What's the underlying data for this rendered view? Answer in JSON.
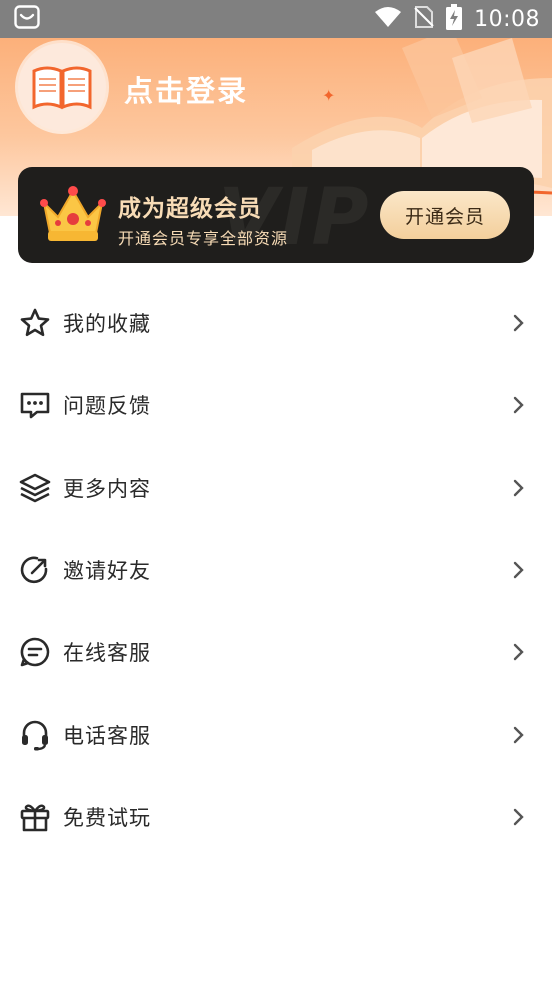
{
  "status_bar": {
    "time": "10:08",
    "icons": [
      "notification-icon",
      "wifi-icon",
      "no-sim-icon",
      "battery-icon"
    ]
  },
  "header": {
    "login_text": "点击登录",
    "avatar_icon": "book-icon"
  },
  "vip": {
    "watermark": "VIP",
    "title": "成为超级会员",
    "subtitle": "开通会员专享全部资源",
    "button_label": "开通会员",
    "crown_icon": "crown-icon"
  },
  "menu": {
    "items": [
      {
        "label": "我的收藏",
        "icon": "star-icon"
      },
      {
        "label": "问题反馈",
        "icon": "feedback-icon"
      },
      {
        "label": "更多内容",
        "icon": "layers-icon"
      },
      {
        "label": "邀请好友",
        "icon": "share-icon"
      },
      {
        "label": "在线客服",
        "icon": "chat-icon"
      },
      {
        "label": "电话客服",
        "icon": "headset-icon"
      },
      {
        "label": "免费试玩",
        "icon": "gift-icon"
      }
    ]
  },
  "colors": {
    "header_accent": "#fcb07a",
    "vip_card_bg": "#1f1e1c",
    "vip_text": "#f8dcb6",
    "vip_button": "#f3cf9c"
  }
}
